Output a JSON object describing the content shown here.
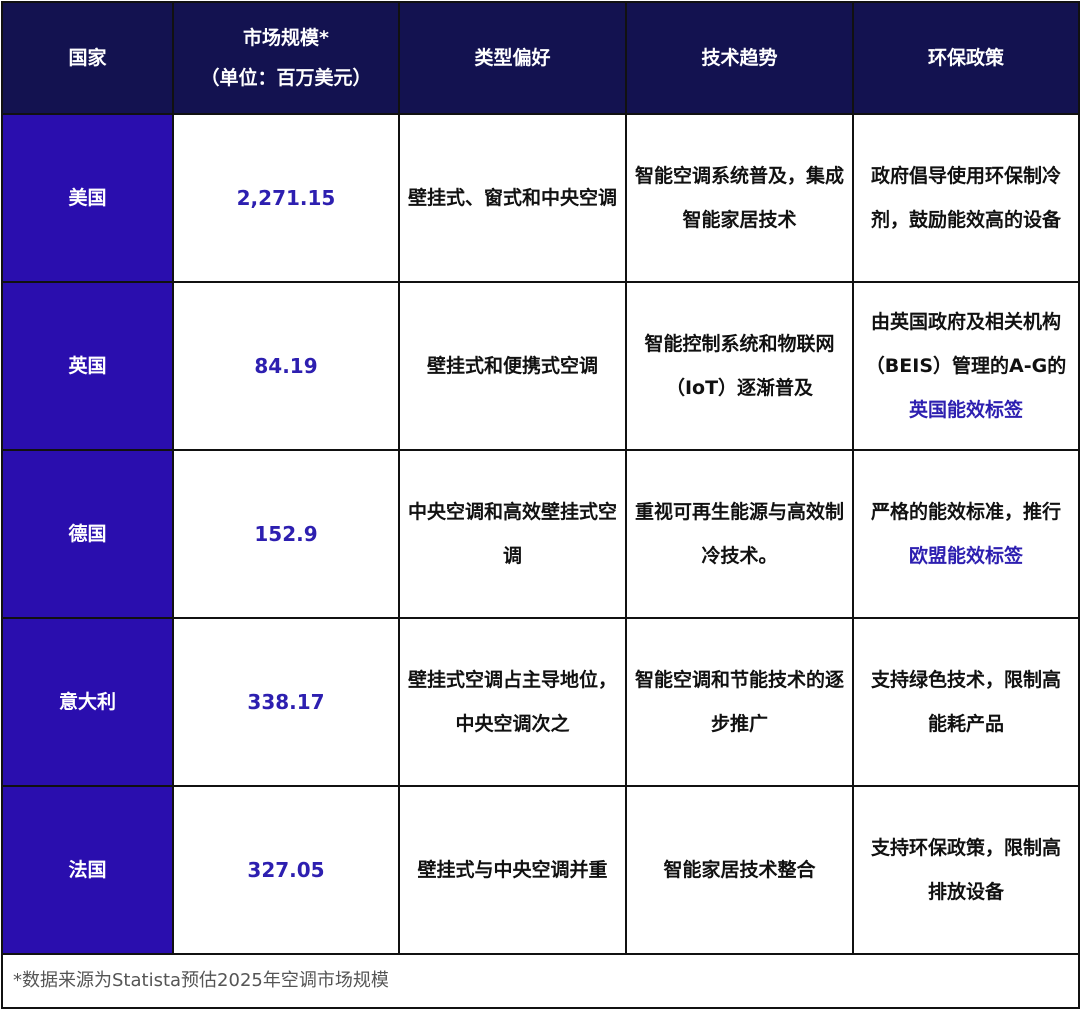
{
  "headers": [
    "国家",
    "市场规模*",
    "（单位：百万美元）",
    "类型偏好",
    "技术趋势",
    "环保政策"
  ],
  "rows": [
    {
      "country": "美国",
      "size": "2,271.15",
      "type": "壁挂式、窗式和中央空调",
      "tech": "智能空调系统普及，集成智能家居技术",
      "policy": "政府倡导使用环保制冷剂，鼓励能效高的设备",
      "policy_link": ""
    },
    {
      "country": "英国",
      "size": "84.19",
      "type": "壁挂式和便携式空调",
      "tech": "智能控制系统和物联网（IoT）逐渐普及",
      "policy": "由英国政府及相关机构（BEIS）管理的A-G的",
      "policy_link": "英国能效标签"
    },
    {
      "country": "德国",
      "size": "152.9",
      "type": "中央空调和高效壁挂式空调",
      "tech": "重视可再生能源与高效制冷技术。",
      "policy": "严格的能效标准，推行",
      "policy_link": "欧盟能效标签"
    },
    {
      "country": "意大利",
      "size": "338.17",
      "type": "壁挂式空调占主导地位，中央空调次之",
      "tech": "智能空调和节能技术的逐步推广",
      "policy": "支持绿色技术，限制高能耗产品",
      "policy_link": ""
    },
    {
      "country": "法国",
      "size": "327.05",
      "type": "壁挂式与中央空调并重",
      "tech": "智能家居技术整合",
      "policy": "支持环保政策，限制高排放设备",
      "policy_link": ""
    }
  ],
  "footnote": "*数据来源为Statista预估2025年空调市场规模"
}
